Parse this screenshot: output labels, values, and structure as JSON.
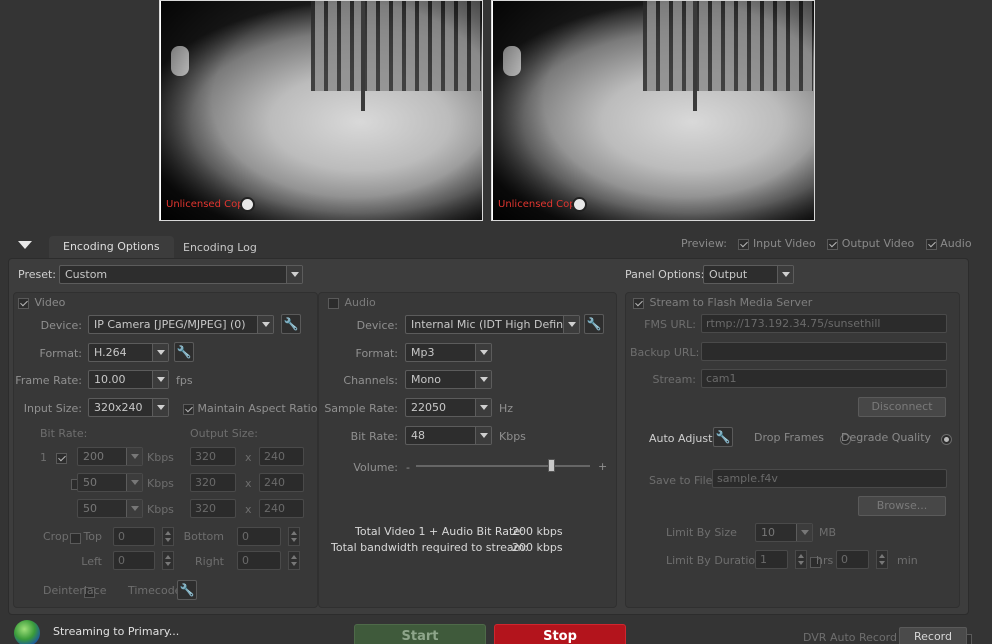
{
  "preview": {
    "watermark_left": "Unlicensed Copy",
    "watermark_right": "Unlicensed Copy"
  },
  "tabs": {
    "encoding_options": "Encoding Options",
    "encoding_log": "Encoding Log"
  },
  "preview_toggles": {
    "label": "Preview:",
    "input_video": "Input Video",
    "output_video": "Output Video",
    "audio": "Audio"
  },
  "preset": {
    "label": "Preset:",
    "value": "Custom"
  },
  "panel_options": {
    "label": "Panel Options:",
    "value": "Output"
  },
  "video": {
    "title": "Video",
    "device_label": "Device:",
    "device": "IP Camera [JPEG/MJPEG] (0)",
    "format_label": "Format:",
    "format": "H.264",
    "frame_rate_label": "Frame Rate:",
    "frame_rate": "10.00",
    "frame_rate_unit": "fps",
    "input_size_label": "Input Size:",
    "input_size": "320x240",
    "maintain_aspect": "Maintain Aspect Ratio",
    "bit_rate_label": "Bit Rate:",
    "output_size_label": "Output Size:",
    "rows": [
      {
        "index": "1",
        "bitrate": "200",
        "unit": "Kbps",
        "w": "320",
        "x": "x",
        "h": "240"
      },
      {
        "index": "",
        "bitrate": "50",
        "unit": "Kbps",
        "w": "320",
        "x": "x",
        "h": "240"
      },
      {
        "index": "",
        "bitrate": "50",
        "unit": "Kbps",
        "w": "320",
        "x": "x",
        "h": "240"
      }
    ],
    "crop_label": "Crop",
    "top_label": "Top",
    "top": "0",
    "bottom_label": "Bottom",
    "bottom": "0",
    "left_label": "Left",
    "left": "0",
    "right_label": "Right",
    "right": "0",
    "deinterlace_label": "Deinterlace",
    "timecode_label": "Timecode"
  },
  "audio": {
    "title": "Audio",
    "device_label": "Device:",
    "device": "Internal Mic (IDT High Definiti",
    "format_label": "Format:",
    "format": "Mp3",
    "channels_label": "Channels:",
    "channels": "Mono",
    "sample_rate_label": "Sample Rate:",
    "sample_rate": "22050",
    "sample_rate_unit": "Hz",
    "bit_rate_label": "Bit Rate:",
    "bit_rate": "48",
    "bit_rate_unit": "Kbps",
    "volume_label": "Volume:",
    "volume_min": "-",
    "volume_max": "+",
    "volume_level": 0.78
  },
  "totals": {
    "total_label": "Total Video 1 + Audio Bit Rate:",
    "total_value": "200 kbps",
    "bandwidth_label": "Total bandwidth required to stream:",
    "bandwidth_value": "200 kbps"
  },
  "output": {
    "stream_label": "Stream to Flash Media Server",
    "fms_url_label": "FMS URL:",
    "fms_url": "rtmp://173.192.34.75/sunsethill",
    "backup_url_label": "Backup URL:",
    "backup_url": "",
    "stream_name_label": "Stream:",
    "stream_name": "cam1",
    "disconnect": "Disconnect",
    "auto_adjust": "Auto Adjust",
    "drop_frames": "Drop Frames",
    "degrade_quality": "Degrade Quality",
    "save_to_file": "Save to File",
    "file_name": "sample.f4v",
    "browse": "Browse...",
    "limit_by_size": "Limit By Size",
    "size_value": "10",
    "size_unit": "MB",
    "limit_by_duration": "Limit By Duration",
    "hrs_value": "1",
    "hrs_unit": "hrs",
    "min_value": "0",
    "min_unit": "min"
  },
  "status": {
    "text": "Streaming to Primary...",
    "start": "Start",
    "stop": "Stop",
    "dvr": "DVR Auto Record",
    "record": "Record"
  },
  "colors": {
    "stop_red": "#b3141c",
    "start_green": "#3f5a3b",
    "watermark_red": "#e0352f"
  }
}
